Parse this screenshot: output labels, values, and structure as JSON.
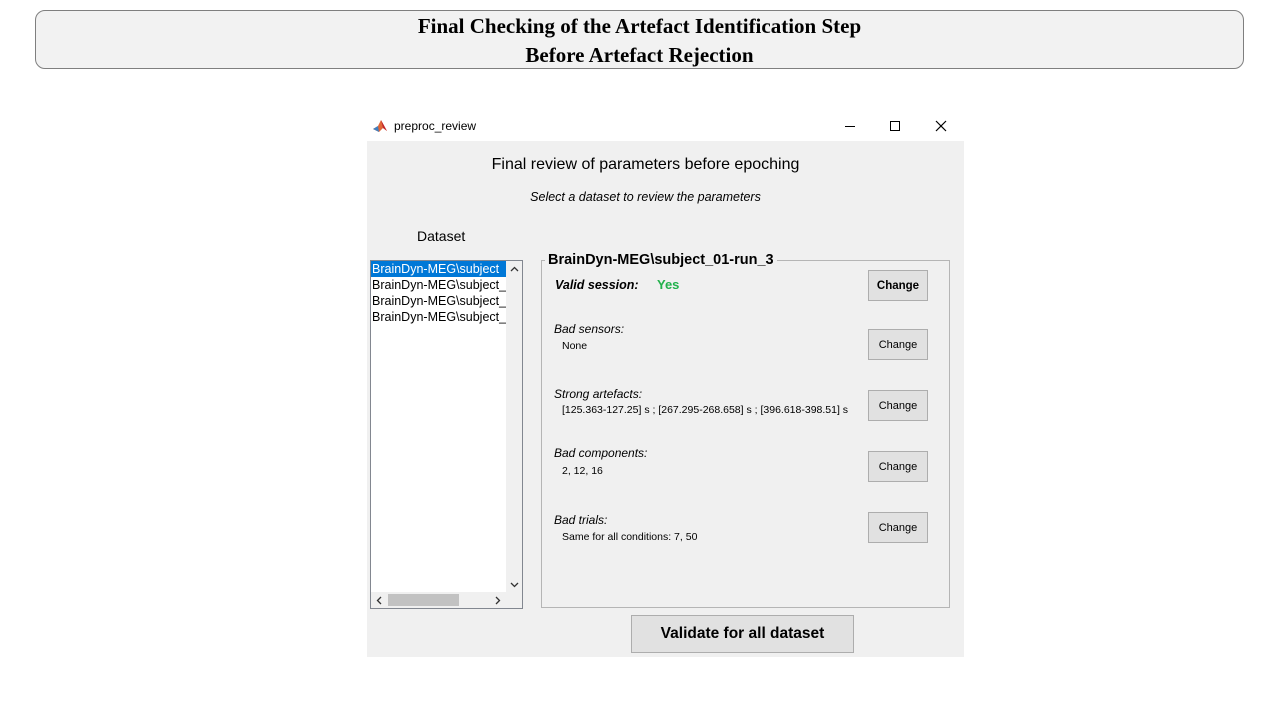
{
  "slide": {
    "title_line1": "Final Checking of the Artefact Identification Step",
    "title_line2": "Before Artefact Rejection"
  },
  "window": {
    "title": "preproc_review",
    "icon": "matlab-icon",
    "controls": [
      "minimize-icon",
      "maximize-icon",
      "close-icon"
    ]
  },
  "header": {
    "heading": "Final review of parameters before epoching",
    "subheading": "Select a dataset to review the parameters"
  },
  "dataset_list": {
    "label": "Dataset",
    "items": [
      "BrainDyn-MEG\\subject",
      "BrainDyn-MEG\\subject_",
      "BrainDyn-MEG\\subject_",
      "BrainDyn-MEG\\subject_"
    ],
    "selected_index": 0
  },
  "panel": {
    "title": "BrainDyn-MEG\\subject_01-run_3",
    "valid_session": {
      "label": "Valid session:",
      "value": "Yes",
      "value_color": "#22b14c",
      "button": "Change"
    },
    "bad_sensors": {
      "label": "Bad sensors:",
      "value": "None",
      "button": "Change"
    },
    "strong_artefacts": {
      "label": "Strong artefacts:",
      "value": "[125.363-127.25] s ; [267.295-268.658] s ; [396.618-398.51] s",
      "button": "Change"
    },
    "bad_components": {
      "label": "Bad components:",
      "value": "2, 12, 16",
      "button": "Change"
    },
    "bad_trials": {
      "label": "Bad trials:",
      "value": "Same for all conditions: 7, 50",
      "button": "Change"
    }
  },
  "footer": {
    "validate_label": "Validate for all dataset"
  },
  "colors": {
    "selection": "#0078d7",
    "window_bg": "#f0f0f0",
    "button_bg": "#e1e1e1"
  }
}
